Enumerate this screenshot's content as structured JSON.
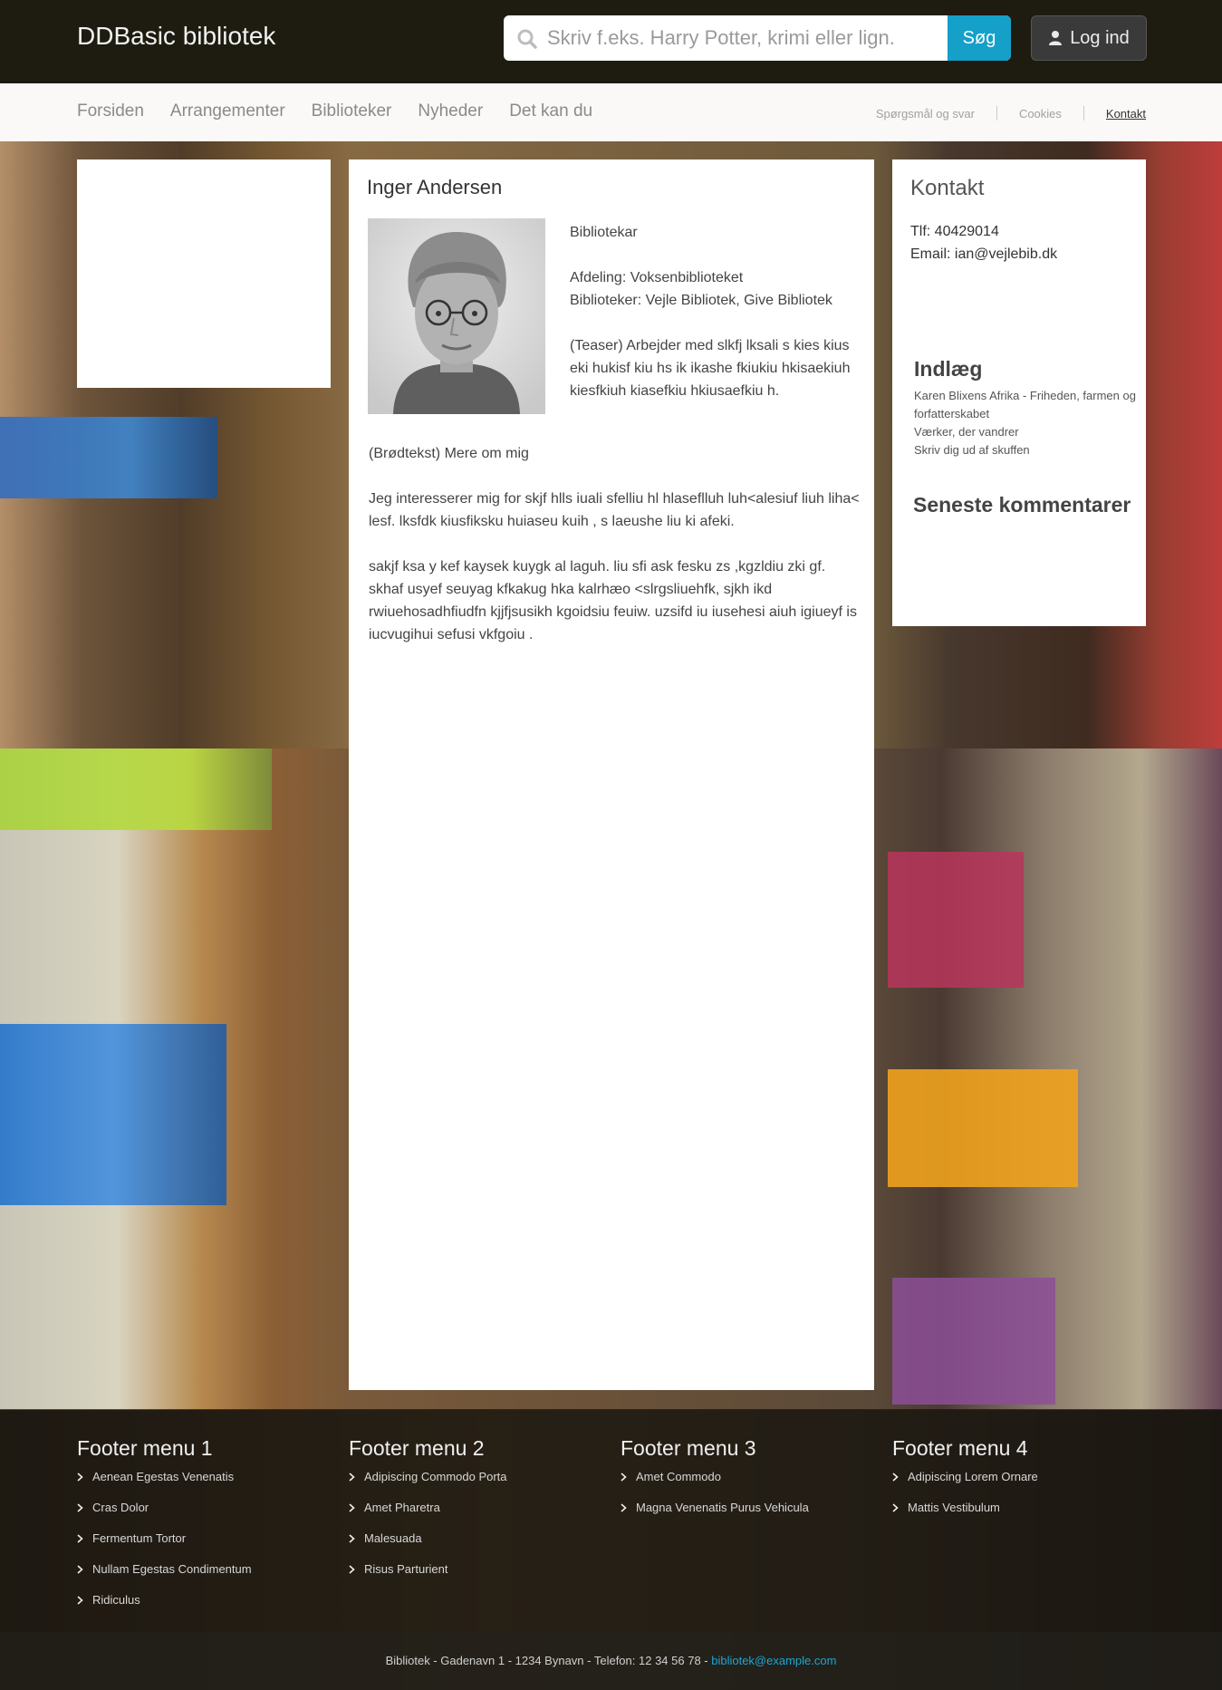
{
  "header": {
    "site_title": "DDBasic bibliotek",
    "search_placeholder": "Skriv f.eks. Harry Potter, krimi eller lign.",
    "search_button": "Søg",
    "login_label": "Log ind"
  },
  "nav": {
    "main": [
      "Forsiden",
      "Arrangementer",
      "Biblioteker",
      "Nyheder",
      "Det kan du"
    ],
    "utility": [
      {
        "label": "Spørgsmål og svar",
        "active": false
      },
      {
        "label": "Cookies",
        "active": false
      },
      {
        "label": "Kontakt",
        "active": true
      }
    ]
  },
  "profile": {
    "name": "Inger Andersen",
    "title": "Bibliotekar",
    "department": "Afdeling: Voksenbiblioteket",
    "libraries": "Biblioteker: Vejle Bibliotek, Give Bibliotek",
    "teaser": "(Teaser) Arbejder med slkfj lksali s kies kius eki hukisf  kiu hs ik ikashe fkiukiu hkisaekiuh kiesfkiuh kiasefkiu hkiusaefkiu h.",
    "body": [
      "(Brødtekst) Mere om mig",
      "Jeg interesserer mig for skjf hlls iuali sfelliu hl hlaseflluh luh<alesiuf liuh liha< lesf. lksfdk kiusfiksku huiaseu kuih ,  s laeushe liu ki afeki.",
      "sakjf ksa y kef kaysek kuygk al laguh. liu sfi  ask fesku zs ,kgzldiu zki gf. skhaf usyef seuyag kfkakug hka kalrhæo <slrgsliuehfk, sjkh ikd rwiuehosadhfiudfn kjjfjsusikh kgoidsiu feuiw. uzsifd iu  iusehesi aiuh igiueyf is iucvugihui sefusi vkfgoiu ."
    ]
  },
  "sidebar": {
    "kontakt_title": "Kontakt",
    "phone": "Tlf: 40429014",
    "email": "Email: ian@vejlebib.dk",
    "indlaeg_title": "Indlæg",
    "indlaeg_items": [
      "Karen Blixens Afrika - Friheden, farmen og forfatterskabet",
      "Værker, der vandrer",
      "Skriv dig ud af skuffen"
    ],
    "comments_title": "Seneste kommentarer"
  },
  "footer": {
    "columns": [
      {
        "title": "Footer menu 1",
        "items": [
          "Aenean Egestas Venenatis",
          "Cras Dolor",
          "Fermentum Tortor",
          "Nullam Egestas Condimentum",
          "Ridiculus"
        ]
      },
      {
        "title": "Footer menu 2",
        "items": [
          "Adipiscing Commodo Porta",
          "Amet Pharetra",
          "Malesuada",
          "Risus Parturient"
        ]
      },
      {
        "title": "Footer menu 3",
        "items": [
          "Amet Commodo",
          "Magna Venenatis Purus Vehicula"
        ]
      },
      {
        "title": "Footer menu 4",
        "items": [
          "Adipiscing Lorem Ornare",
          "Mattis Vestibulum"
        ]
      }
    ],
    "address": "Bibliotek - Gadenavn 1 - 1234 Bynavn - Telefon: 12 34 56 78 - ",
    "email": "bibliotek@example.com"
  },
  "colors": {
    "accent": "#14a0c9",
    "header_bg": "#1c190f",
    "link": "#1fa5d1"
  }
}
